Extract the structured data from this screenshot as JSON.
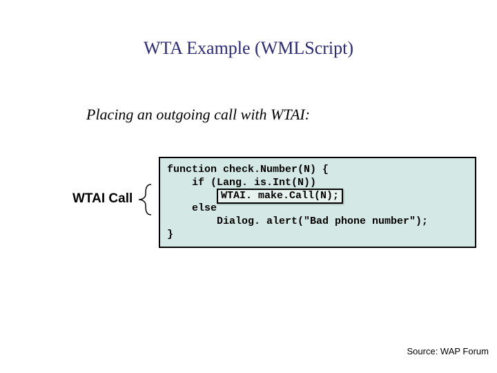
{
  "title": "WTA Example (WMLScript)",
  "subtitle": "Placing an outgoing call with WTAI:",
  "label": "WTAI Call",
  "code": {
    "l1": "function check.Number(N) {",
    "l2": "    if (Lang. is.Int(N))",
    "l3_indent": "        ",
    "l3_call": "WTAI. make.Call(N);",
    "l4": "    else",
    "l5": "        Dialog. alert(\"Bad phone number\");",
    "l6": "}"
  },
  "source": "Source: WAP Forum"
}
